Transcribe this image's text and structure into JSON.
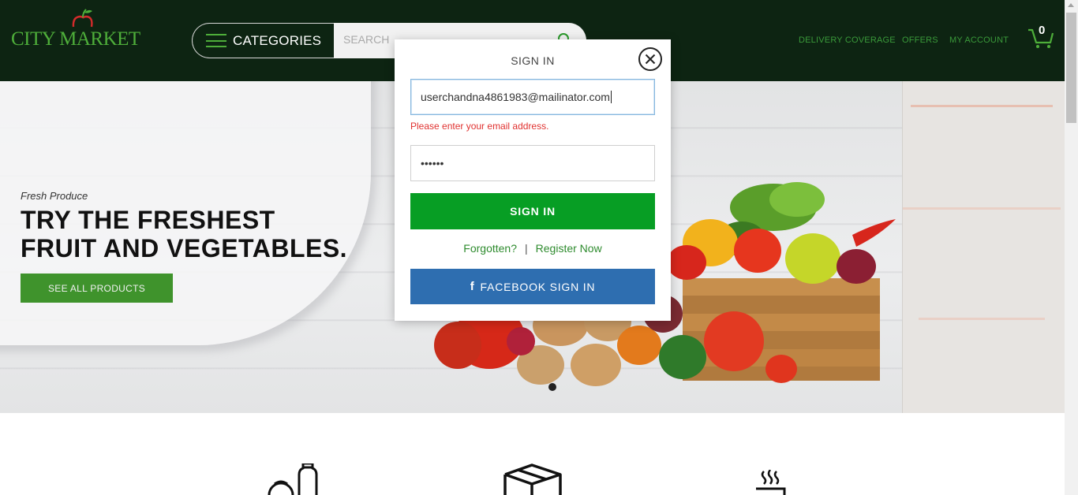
{
  "header": {
    "logo_text": "CITY MARKET",
    "categories_label": "CATEGORIES",
    "search_placeholder": "SEARCH",
    "nav": {
      "delivery": "DELIVERY COVERAGE",
      "offers": "OFFERS",
      "account": "MY ACCOUNT"
    },
    "cart_count": "0",
    "colors": {
      "background": "#0d2412",
      "accent": "#4eae3a"
    }
  },
  "hero": {
    "kicker": "Fresh Produce",
    "title_line1": "TRY THE FRESHEST",
    "title_line2": "FRUIT AND VEGETABLES.",
    "button_label": "SEE ALL PRODUCTS"
  },
  "features": {
    "icons": [
      "groceries-icon",
      "box-icon",
      "hot-drink-icon"
    ]
  },
  "modal": {
    "title": "SIGN IN",
    "email_value": "userchandna4861983@mailinator.com",
    "error_text": "Please enter your email address.",
    "password_value": "••••••",
    "signin_label": "SIGN IN",
    "forgot_label": "Forgotten?",
    "separator": "|",
    "register_label": "Register Now",
    "facebook_icon_glyph": "f",
    "facebook_label": "FACEBOOK SIGN IN",
    "colors": {
      "signin": "#079e24",
      "facebook": "#2e6eb0",
      "error": "#e0312f"
    }
  }
}
